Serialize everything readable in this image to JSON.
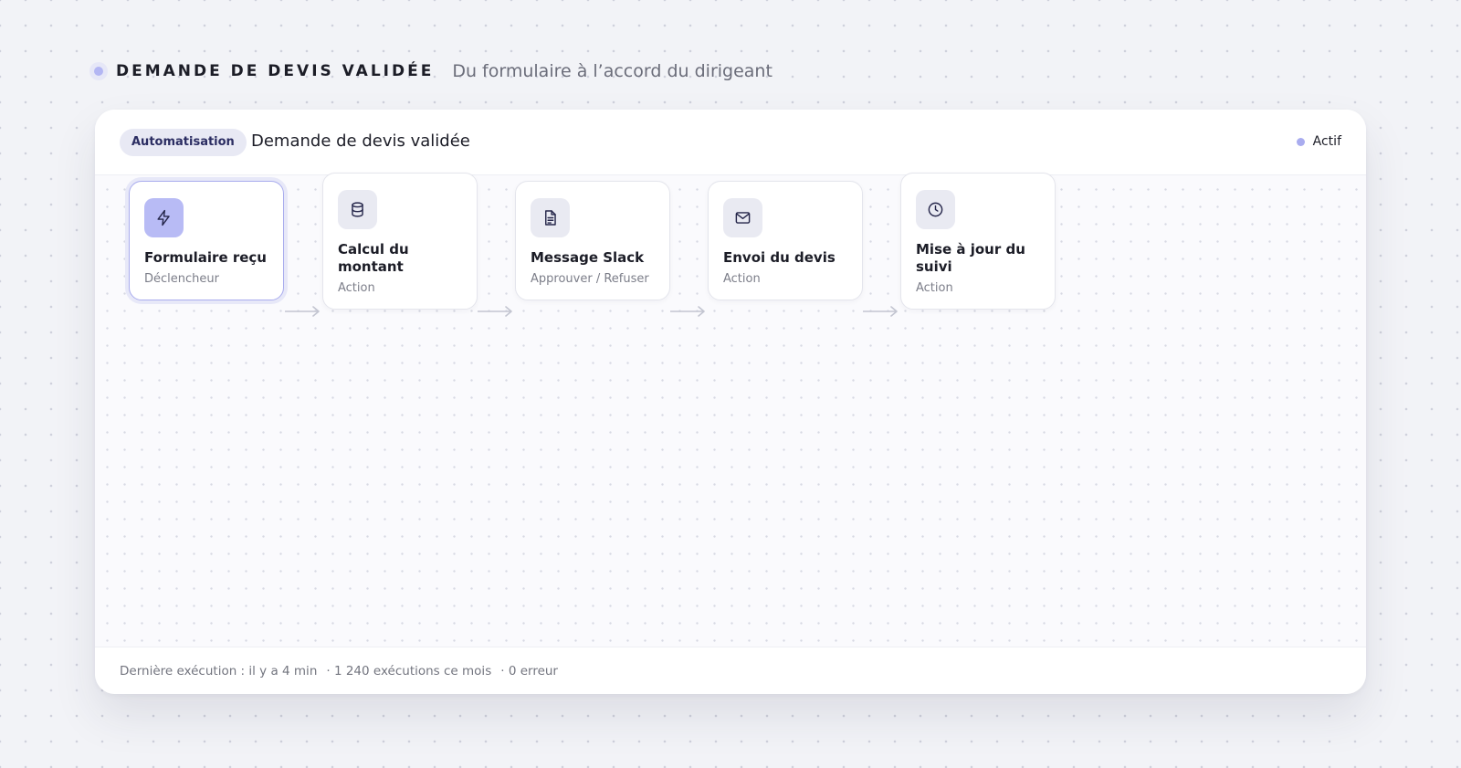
{
  "header": {
    "title": "DEMANDE DE DEVIS VALIDÉE",
    "subtitle": "Du formulaire à l’accord du dirigeant"
  },
  "card": {
    "tag": "Automatisation",
    "title": "Demande de devis validée",
    "status": "Actif"
  },
  "nodes": [
    {
      "title": "Formulaire reçu",
      "subtitle": "Déclencheur",
      "icon": "lightning-icon"
    },
    {
      "title": "Calcul du montant",
      "subtitle": "Action",
      "icon": "database-icon"
    },
    {
      "title": "Message Slack",
      "subtitle": "Approuver / Refuser",
      "icon": "document-icon"
    },
    {
      "title": "Envoi du devis",
      "subtitle": "Action",
      "icon": "mail-icon"
    },
    {
      "title": "Mise à jour du suivi",
      "subtitle": "Action",
      "icon": "clock-icon"
    }
  ],
  "footer": {
    "last_run": "Dernière exécution : il y a 4 min",
    "runs": "· 1 240 exécutions ce mois",
    "errors": "· 0 erreur"
  },
  "colors": {
    "accent": "#b8bbf5",
    "status_dot": "#a9acef",
    "tag_bg": "#e8e9f4"
  }
}
